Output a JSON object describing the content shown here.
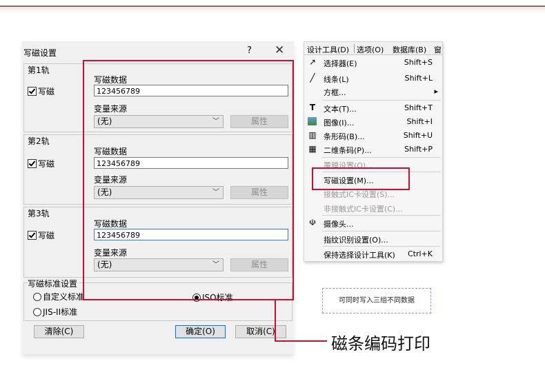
{
  "dialog": {
    "title": "写磁设置",
    "help": "?",
    "close": "✕",
    "tracks": [
      {
        "label": "第1轨",
        "checkbox": "写磁",
        "data_label": "写磁数据",
        "data_value": "123456789",
        "source_label": "变量来源",
        "source_value": "(无)",
        "attr_button": "属性"
      },
      {
        "label": "第2轨",
        "checkbox": "写磁",
        "data_label": "写磁数据",
        "data_value": "123456789",
        "source_label": "变量来源",
        "source_value": "(无)",
        "attr_button": "属性"
      },
      {
        "label": "第3轨",
        "checkbox": "写磁",
        "data_label": "写磁数据",
        "data_value": "123456789",
        "source_label": "变量来源",
        "source_value": "(无)",
        "attr_button": "属性"
      }
    ],
    "standard": {
      "title": "写磁标准设置",
      "options": [
        "自定义标准",
        "JIS-II标准",
        "ISO标准"
      ],
      "selected": "ISO标准"
    },
    "buttons": {
      "clear": "清除(C)",
      "ok": "确定(O)",
      "cancel": "取消(C)"
    }
  },
  "menu": {
    "bar": [
      "设计工具(D)",
      "选项(O)",
      "数据库(B)",
      "窗"
    ],
    "items": [
      {
        "icon": "selector-icon",
        "label": "选择器(E)",
        "shortcut": "Shift+S",
        "disabled": false
      },
      {
        "icon": "line-icon",
        "label": "线条(L)",
        "shortcut": "Shift+L",
        "disabled": false
      },
      {
        "icon": "",
        "label": "方框...",
        "shortcut": "▸",
        "disabled": false
      },
      {
        "icon": "text-icon",
        "label": "文本(T)...",
        "shortcut": "Shift+T",
        "disabled": false
      },
      {
        "icon": "image-icon",
        "label": "图像(I)...",
        "shortcut": "Shift+I",
        "disabled": false
      },
      {
        "icon": "barcode-icon",
        "label": "条形码(B)...",
        "shortcut": "Shift+U",
        "disabled": false
      },
      {
        "icon": "qrcode-icon",
        "label": "二维条码(P)...",
        "shortcut": "Shift+P",
        "disabled": false
      },
      {
        "icon": "",
        "label": "覆膜设置(O)...",
        "shortcut": "",
        "disabled": true
      },
      {
        "icon": "",
        "label": "写磁设置(M)...",
        "shortcut": "",
        "disabled": false
      },
      {
        "icon": "",
        "label": "接触式IC卡设置(S)...",
        "shortcut": "",
        "disabled": true
      },
      {
        "icon": "",
        "label": "非接触式IC卡设置(C)...",
        "shortcut": "",
        "disabled": true
      },
      {
        "icon": "camera-icon",
        "label": "摄像头...",
        "shortcut": "",
        "disabled": false
      },
      {
        "icon": "",
        "label": "指纹识别设置(O)...",
        "shortcut": "",
        "disabled": false
      },
      {
        "icon": "",
        "label": "保持选择设计工具(K)",
        "shortcut": "Ctrl+K",
        "disabled": false
      }
    ]
  },
  "note": "可同时写入三组不同数据",
  "caption": "磁条编码打印",
  "colors": {
    "highlight": "#c8102e",
    "note_border": "#9b8fd0",
    "top_rule": "#8a6e5a"
  }
}
